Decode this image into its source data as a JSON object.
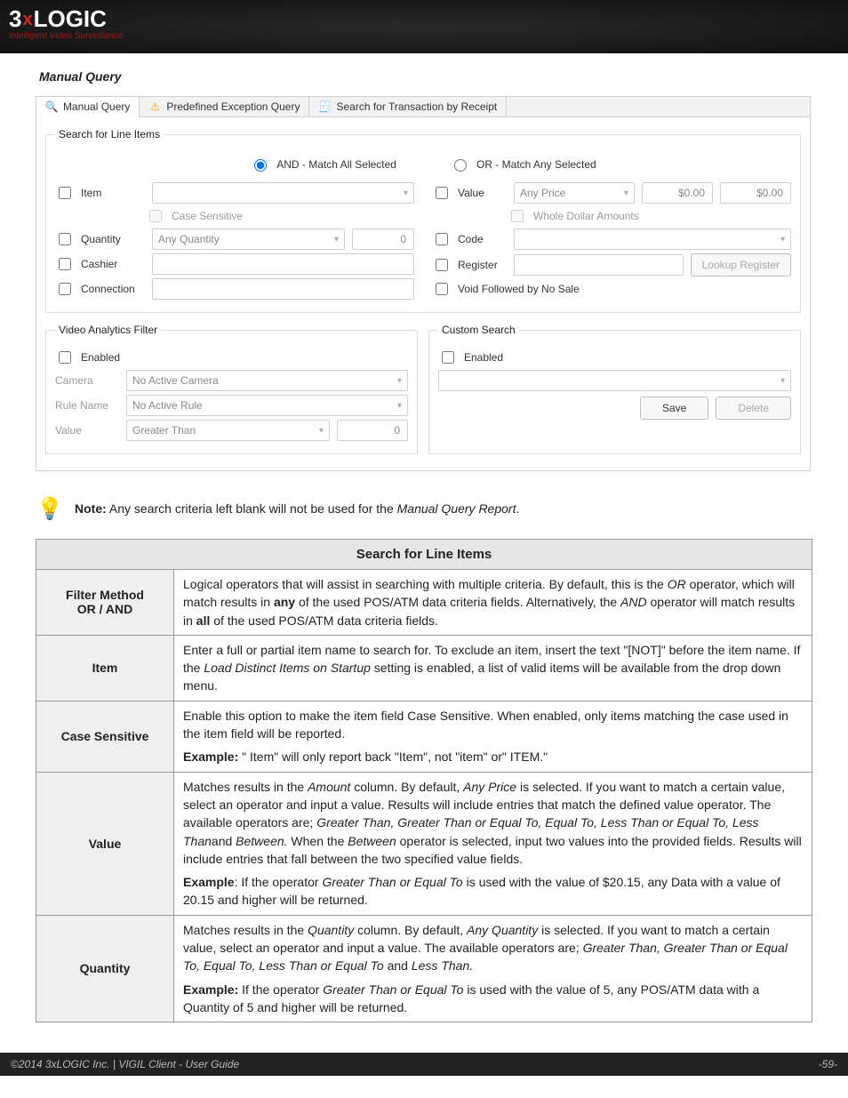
{
  "brand": {
    "logo_prefix": "3",
    "logo_x": "x",
    "logo_suffix": "LOGIC",
    "tagline": "Intelligent Video Surveillance"
  },
  "section": {
    "title": "Manual Query"
  },
  "tabs": {
    "t0": "Manual Query",
    "t1": "Predefined Exception Query",
    "t2": "Search for Transaction by Receipt"
  },
  "groups": {
    "search_items": "Search for Line Items",
    "video_filter": "Video Analytics Filter",
    "custom_search": "Custom Search"
  },
  "radios": {
    "and": "AND - Match All Selected",
    "or": "OR - Match Any Selected"
  },
  "labels": {
    "item": "Item",
    "case_sensitive": "Case Sensitive",
    "quantity": "Quantity",
    "cashier": "Cashier",
    "connection": "Connection",
    "value": "Value",
    "any_price": "Any Price",
    "whole_dollar": "Whole Dollar Amounts",
    "code": "Code",
    "register": "Register",
    "lookup_register": "Lookup Register",
    "void_no_sale": "Void Followed by No Sale",
    "enabled": "Enabled",
    "camera": "Camera",
    "no_active_camera": "No Active Camera",
    "rule_name": "Rule Name",
    "no_active_rule": "No Active Rule",
    "value2": "Value",
    "greater_than": "Greater Than",
    "any_quantity": "Any Quantity",
    "zero": "0",
    "money_zero": "$0.00",
    "save": "Save",
    "delete": "Delete"
  },
  "note": {
    "bold": "Note:",
    "body": " Any search criteria left blank will not be used for the ",
    "italic": "Manual Query Report",
    "tail": "."
  },
  "table": {
    "header": "Search for Line Items",
    "rows": {
      "filter_method": {
        "key_line1": "Filter Method",
        "key_line2": "OR / AND",
        "html": "Logical operators that will assist in searching with multiple criteria. By default, this is the <span class='it'>OR</span> operator, which will match results in <b>any</b> of the used POS/ATM data criteria fields. Alternatively, the <span class='it'>AND</span> operator will match results in <b>all</b> of the used POS/ATM data criteria fields."
      },
      "item": {
        "key": "Item",
        "html": "Enter a full or partial item name to search for.  To exclude an item, insert the text &quot;[NOT]&quot; before the item name.  If the <span class='it'>Load Distinct Items on Startup</span> setting is enabled, a list of valid items will be available from the drop down menu."
      },
      "case_sensitive": {
        "key": "Case Sensitive",
        "p1": "Enable this option to make the item field Case Sensitive.  When enabled, only items matching the case used in the item field will be reported.",
        "p2": "<b>Example:</b> &quot; Item&quot; will only report back &quot;Item&quot;, not &quot;item&quot; or&quot; ITEM.&quot;"
      },
      "value": {
        "key": "Value",
        "p1": "Matches results in the <span class='it'>Amount</span> column. By default, <span class='it'>Any Price</span> is selected. If you want to match a certain value, select an operator and input a value. Results will include entries that match the defined value operator. The available operators are; <span class='it'>Greater Than, Greater Than or Equal To, Equal To, Less Than or Equal To, Less Than</span>and <span class='it'>Between.</span> When the <span class='it'>Between</span> operator is selected, input two values into the provided fields. Results will include entries that fall between the two specified value fields.",
        "p2": "<b>Example</b>: If the operator <span class='it'>Greater Than or Equal To</span> is used with the value of $20.15, any Data with a value of 20.15 and higher will be returned."
      },
      "quantity": {
        "key": "Quantity",
        "p1": "Matches results in the <span class='it'>Quantity</span> column. By default, <span class='it'>Any Quantity</span> is selected. If you want to match a certain value, select an operator and input a value. The available operators are; <span class='it'>Greater Than, Greater Than or Equal To, Equal To, Less Than or Equal To</span> and <span class='it'>Less Than.</span>",
        "p2": "<b>Example:</b> If the operator <span class='it'>Greater Than or Equal To</span> is used with the value of 5, any POS/ATM data with a Quantity of 5 and higher will be returned."
      }
    }
  },
  "footer": {
    "left": "©2014 3xLOGIC Inc.  |  VIGIL Client - User Guide",
    "right": "-59-"
  }
}
